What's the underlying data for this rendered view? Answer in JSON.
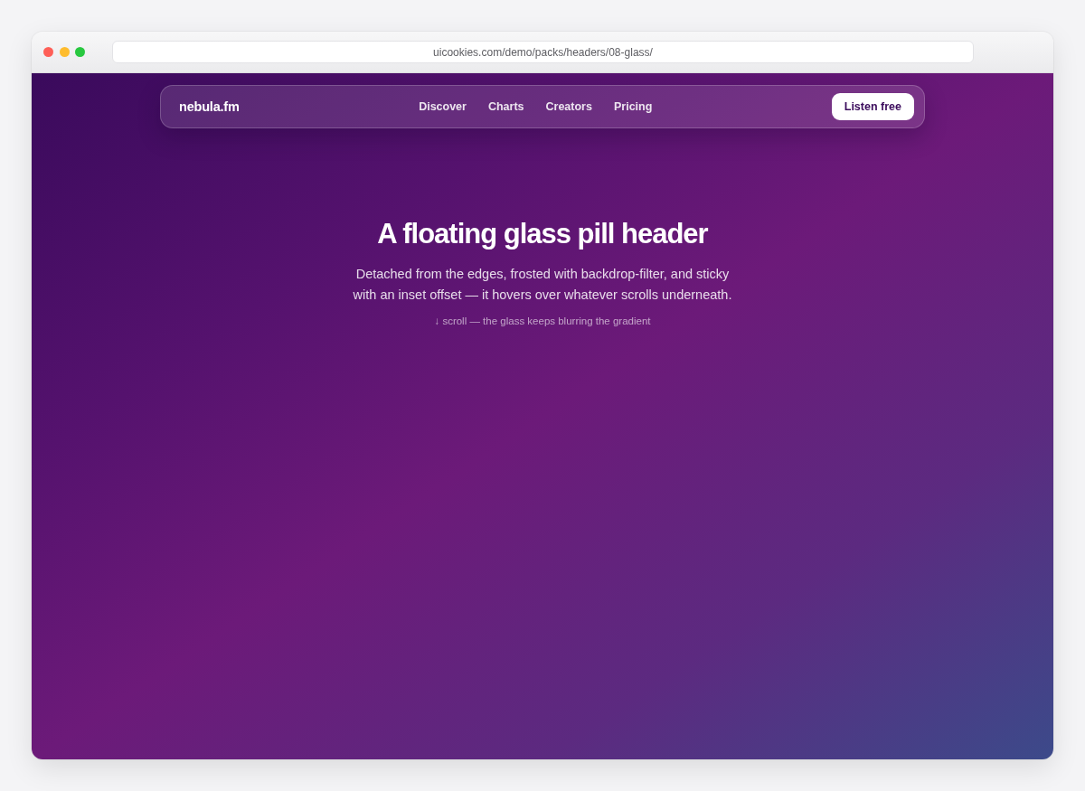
{
  "browser": {
    "url": "uicookies.com/demo/packs/headers/08-glass/"
  },
  "header": {
    "logo": "nebula.fm",
    "nav": [
      {
        "label": "Discover"
      },
      {
        "label": "Charts"
      },
      {
        "label": "Creators"
      },
      {
        "label": "Pricing"
      }
    ],
    "cta": "Listen free"
  },
  "hero": {
    "title": "A floating glass pill header",
    "description": "Detached from the edges, frosted with backdrop-filter, and sticky with an inset offset — it hovers over whatever scrolls underneath.",
    "hint": "↓ scroll — the glass keeps blurring the gradient"
  }
}
